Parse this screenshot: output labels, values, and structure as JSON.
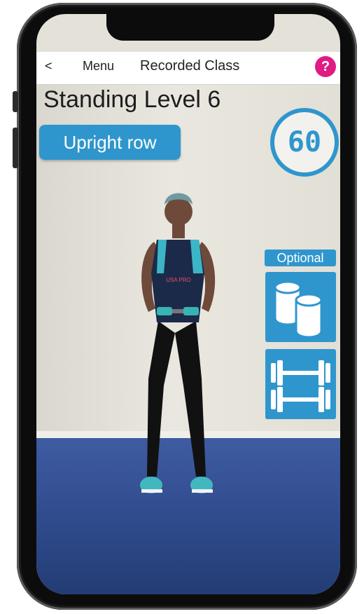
{
  "nav": {
    "back": "<",
    "menu": "Menu",
    "title": "Recorded Class",
    "help": "?"
  },
  "class": {
    "title": "Standing Level 6",
    "exercise": "Upright row",
    "timer": "60"
  },
  "equipment": {
    "label": "Optional",
    "items": [
      "cans-icon",
      "dumbbells-icon"
    ]
  },
  "shirt_text": "USA PRO",
  "colors": {
    "accent": "#2f96cd",
    "help": "#e01b84"
  }
}
